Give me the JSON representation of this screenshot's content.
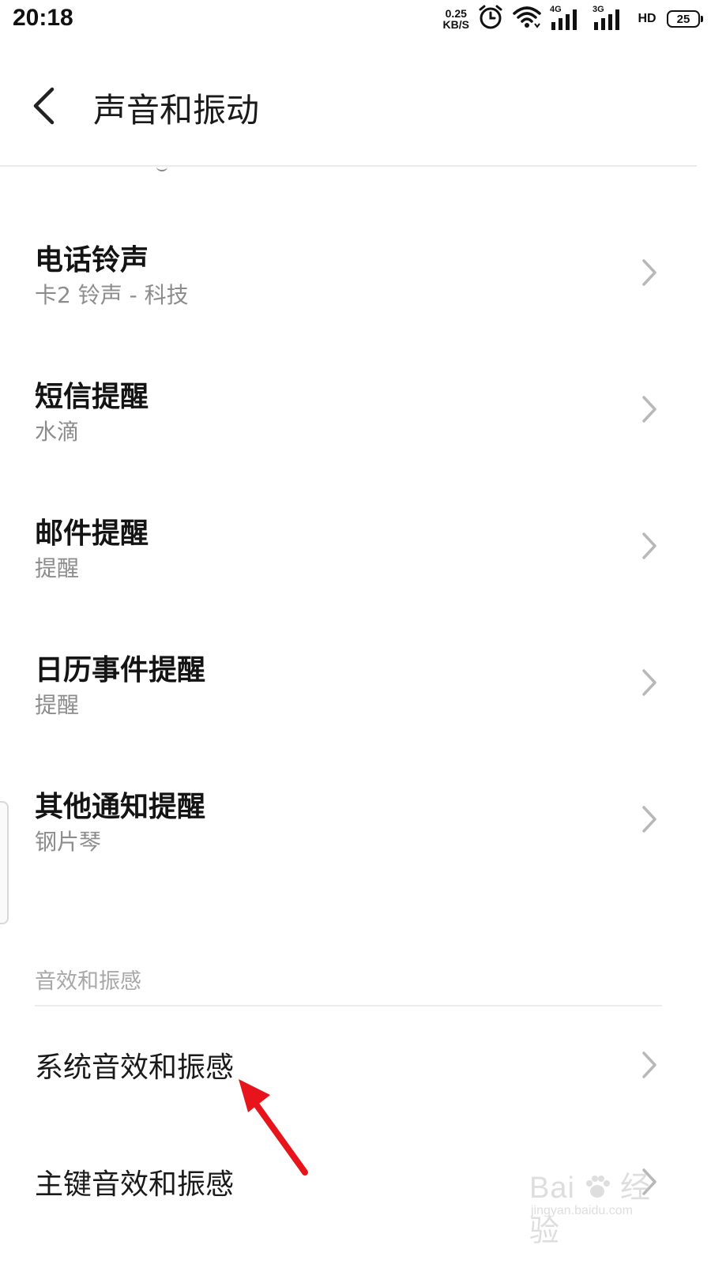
{
  "status_bar": {
    "time": "20:18",
    "net_speed_value": "0.25",
    "net_speed_unit": "KB/S",
    "sim1_label": "4G",
    "sim2_label": "3G",
    "hd_label": "HD",
    "battery_level": "25"
  },
  "header": {
    "title": "声音和振动"
  },
  "ringtone_items": [
    {
      "title": "电话铃声",
      "subtitle": "卡2 铃声 - 科技"
    },
    {
      "title": "短信提醒",
      "subtitle": "水滴"
    },
    {
      "title": "邮件提醒",
      "subtitle": "提醒"
    },
    {
      "title": "日历事件提醒",
      "subtitle": "提醒"
    },
    {
      "title": "其他通知提醒",
      "subtitle": "钢片琴"
    }
  ],
  "section": {
    "header": "音效和振感",
    "items": [
      {
        "title": "系统音效和振感"
      },
      {
        "title": "主键音效和振感"
      }
    ]
  },
  "watermark": {
    "brand": "Bai",
    "brand_cn": "经验",
    "url": "jingyan.baidu.com"
  },
  "colors": {
    "annotation_arrow": "#e8141c",
    "chevron": "#b8b8b8",
    "subtitle": "#8c8c8c"
  },
  "icons": [
    "back-arrow-icon",
    "alarm-clock-icon",
    "wifi-icon",
    "signal-icon",
    "hd-voice-icon",
    "battery-icon",
    "chevron-right-icon",
    "paw-icon"
  ]
}
